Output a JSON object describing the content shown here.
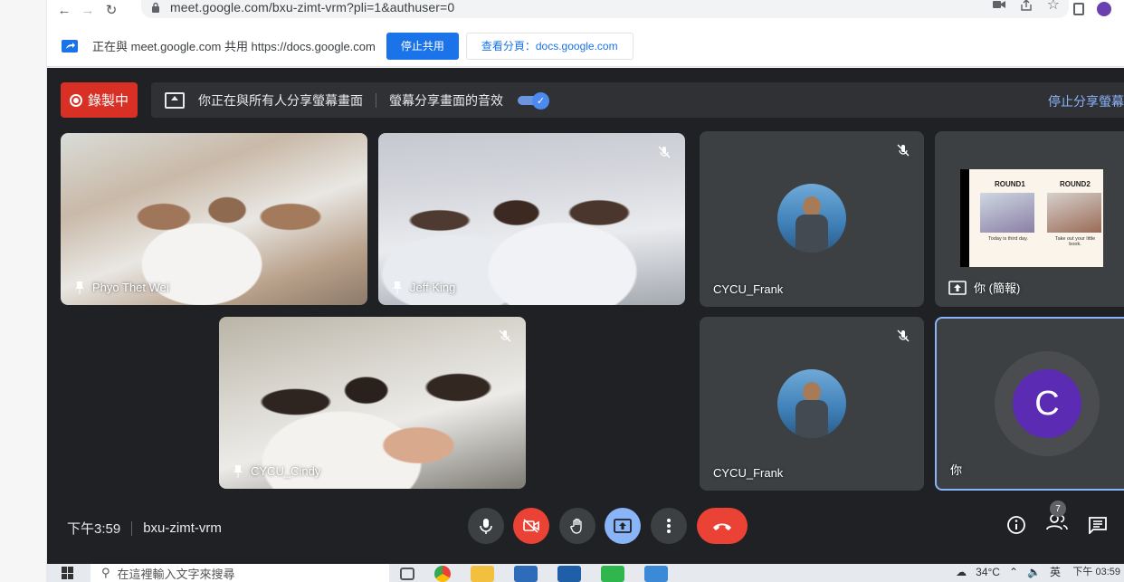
{
  "browser": {
    "url": "meet.google.com/bxu-zimt-vrm?pli=1&authuser=0"
  },
  "share_bar": {
    "text": "正在與 meet.google.com 共用 https://docs.google.com",
    "stop_label": "停止共用",
    "view_tab_label": "查看分頁：docs.google.com"
  },
  "meet": {
    "recording_label": "錄製中",
    "presenting_text": "你正在與所有人分享螢幕畫面",
    "audio_text": "螢幕分享畫面的音效",
    "stop_presenting_label": "停止分享螢幕"
  },
  "tiles": [
    {
      "name": "Phyo Thet Wei",
      "pinned": true
    },
    {
      "name": "Jeff King",
      "pinned": true,
      "muted": true
    },
    {
      "name": "CYCU_Frank",
      "muted": true
    },
    {
      "name": "你 (簡報)",
      "presenting": true
    },
    {
      "name": "CYCU_Cindy",
      "pinned": true,
      "muted": true
    },
    {
      "name": "CYCU_Frank",
      "muted": true
    },
    {
      "name": "你",
      "avatar_letter": "C",
      "self": true
    }
  ],
  "slide": {
    "round1": "ROUND1",
    "round2": "ROUND2",
    "caption1": "Today is third day.",
    "caption2": "Take out your little book."
  },
  "bottom": {
    "time": "下午3:59",
    "meeting_code": "bxu-zimt-vrm",
    "participants_count": "7"
  },
  "taskbar": {
    "search_placeholder": "在這裡輸入文字來搜尋",
    "temperature": "34°C",
    "ime": "英",
    "clock": "下午 03:59"
  },
  "colors": {
    "meet_bg": "#202124",
    "tile_bg": "#3c4043",
    "record_red": "#d93025",
    "accent_blue": "#8ab4f8",
    "share_button_blue": "#1a73e8",
    "avatar_purple": "#5b2bb3"
  }
}
